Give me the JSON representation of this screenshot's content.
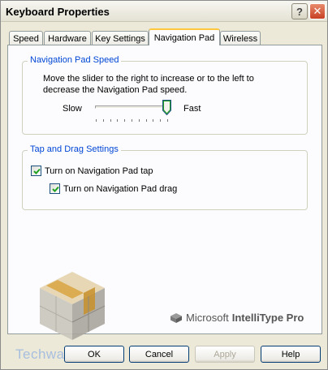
{
  "window": {
    "title": "Keyboard Properties",
    "help_glyph": "?",
    "close_glyph": "✕"
  },
  "tabs": [
    {
      "label": "Speed",
      "active": false
    },
    {
      "label": "Hardware",
      "active": false
    },
    {
      "label": "Key Settings",
      "active": false
    },
    {
      "label": "Navigation Pad",
      "active": true
    },
    {
      "label": "Wireless",
      "active": false
    }
  ],
  "speed_group": {
    "title": "Navigation Pad Speed",
    "description": "Move the slider to the right to increase or to the left to decrease the Navigation Pad speed.",
    "slow_label": "Slow",
    "fast_label": "Fast",
    "slider_value": 1.0,
    "tick_count": 11
  },
  "tap_group": {
    "title": "Tap and Drag Settings",
    "tap_checkbox": {
      "label": "Turn on Navigation Pad tap",
      "checked": true
    },
    "drag_checkbox": {
      "label": "Turn on Navigation Pad drag",
      "checked": true
    }
  },
  "branding": {
    "ms_text": "Microsoft",
    "product_text": "IntelliType Pro",
    "watermark": "TechwareLabs"
  },
  "buttons": {
    "ok": "OK",
    "cancel": "Cancel",
    "apply": "Apply",
    "help": "Help"
  },
  "colors": {
    "group_title": "#0046d5",
    "active_tab_accent": "#ffc83c",
    "close_button": "#c74023"
  },
  "icons": {
    "help": "question-icon",
    "close": "close-icon",
    "check": "checkmark-icon",
    "ms_logo": "microsoft-cube-icon",
    "watermark_logo": "cube-logo-icon"
  }
}
